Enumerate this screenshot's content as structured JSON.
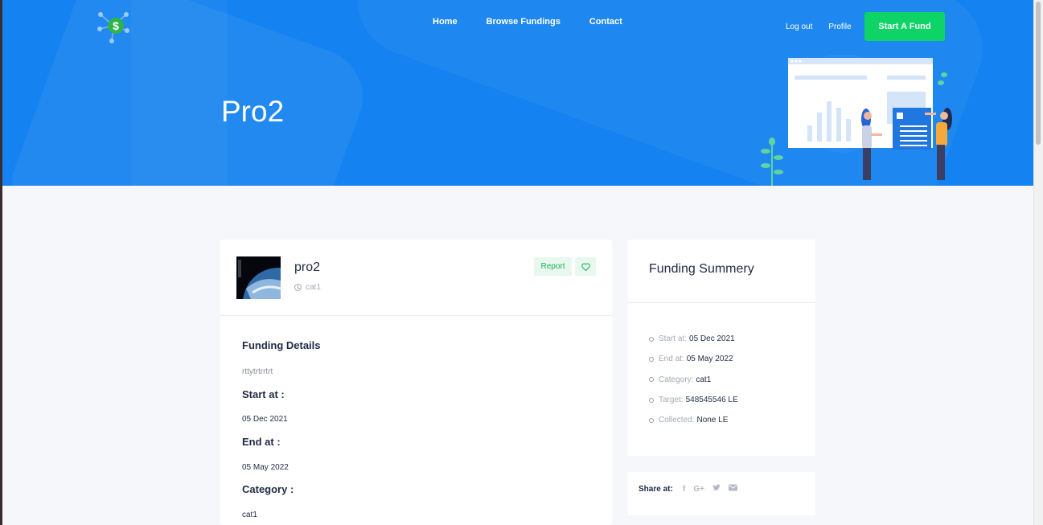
{
  "nav": {
    "items": [
      "Home",
      "Browse Fundings",
      "Contact"
    ],
    "logout": "Log out",
    "profile": "Profile",
    "start_fund": "Start A Fund"
  },
  "hero": {
    "title": "Pro2"
  },
  "project": {
    "name": "pro2",
    "category": "cat1",
    "report_label": "Report",
    "heart_icon": "heart-icon"
  },
  "details": {
    "heading": "Funding Details",
    "description": "rttytrtrrtrt",
    "start_label": "Start at :",
    "start_value": "05 Dec 2021",
    "end_label": "End at :",
    "end_value": "05 May 2022",
    "category_label": "Category :",
    "category_value": "cat1"
  },
  "summary": {
    "title": "Funding Summery",
    "items": [
      {
        "key": "Start at:",
        "value": "05 Dec 2021"
      },
      {
        "key": "End at:",
        "value": "05 May 2022"
      },
      {
        "key": "Category:",
        "value": "cat1"
      },
      {
        "key": "Target:",
        "value": "548545546 LE"
      },
      {
        "key": "Collected:",
        "value": "None LE"
      }
    ]
  },
  "share": {
    "label": "Share at:",
    "icons": [
      "facebook-icon",
      "google-plus-icon",
      "twitter-icon",
      "email-icon"
    ]
  },
  "colors": {
    "hero_bg": "#1482f0",
    "accent_green": "#0ed467",
    "text_dark": "#1f2a44",
    "text_muted": "#a4a9b5"
  }
}
